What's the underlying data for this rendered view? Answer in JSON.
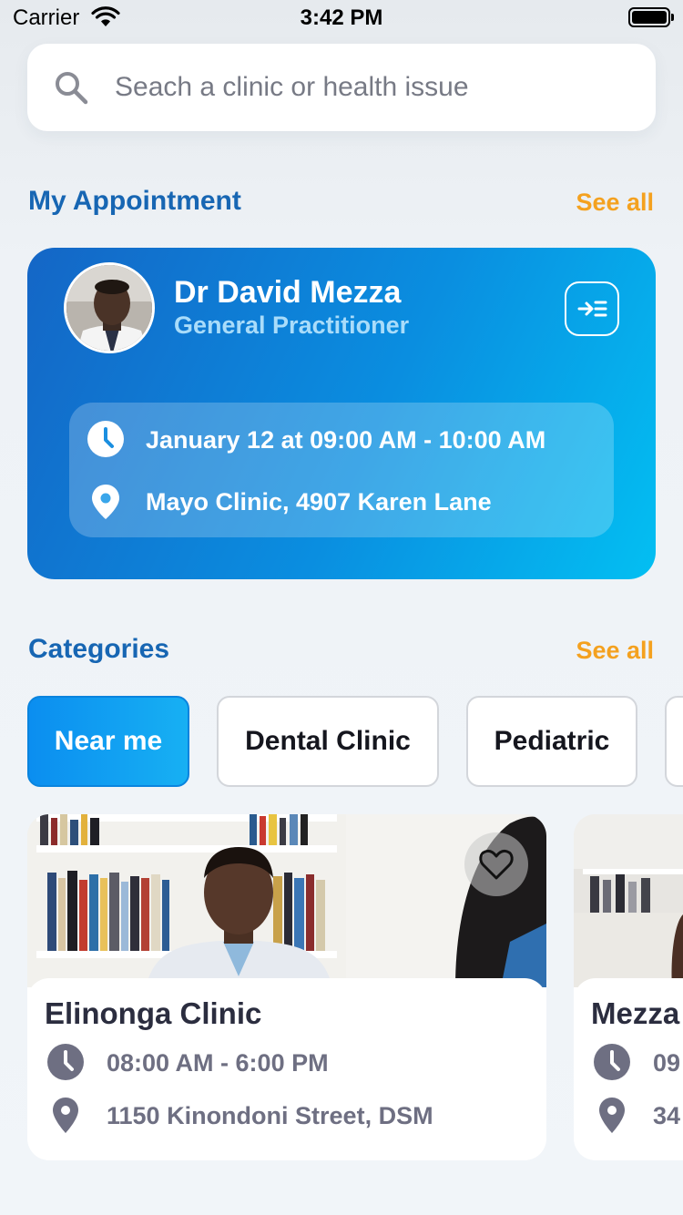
{
  "status_bar": {
    "carrier": "Carrier",
    "time": "3:42 PM"
  },
  "search": {
    "placeholder": "Seach a clinic or health issue",
    "value": ""
  },
  "appointment_section": {
    "title": "My Appointment",
    "see_all": "See all",
    "card": {
      "doctor_name": "Dr David Mezza",
      "doctor_role": "General Practitioner",
      "datetime": "January 12 at 09:00 AM - 10:00 AM",
      "location": "Mayo Clinic, 4907 Karen Lane"
    }
  },
  "categories_section": {
    "title": "Categories",
    "see_all": "See all",
    "chips": [
      {
        "label": "Near me",
        "active": true
      },
      {
        "label": "Dental Clinic",
        "active": false
      },
      {
        "label": "Pediatric",
        "active": false
      }
    ]
  },
  "clinics": [
    {
      "name": "Elinonga Clinic",
      "hours": "08:00 AM - 6:00 PM",
      "address": "1150 Kinondoni Street, DSM"
    },
    {
      "name": "Mezza",
      "hours": "09",
      "address": "34"
    }
  ],
  "colors": {
    "brand_blue": "#1766b3",
    "accent_orange": "#f4a11f",
    "card_gradient_start": "#1466c6",
    "card_gradient_end": "#03bff2",
    "chip_active": "#0b8ef0"
  },
  "icons": {
    "search": "search-icon",
    "appointment_action": "indent-icon",
    "time": "clock-icon",
    "location": "location-pin-icon",
    "favorite": "heart-icon"
  }
}
